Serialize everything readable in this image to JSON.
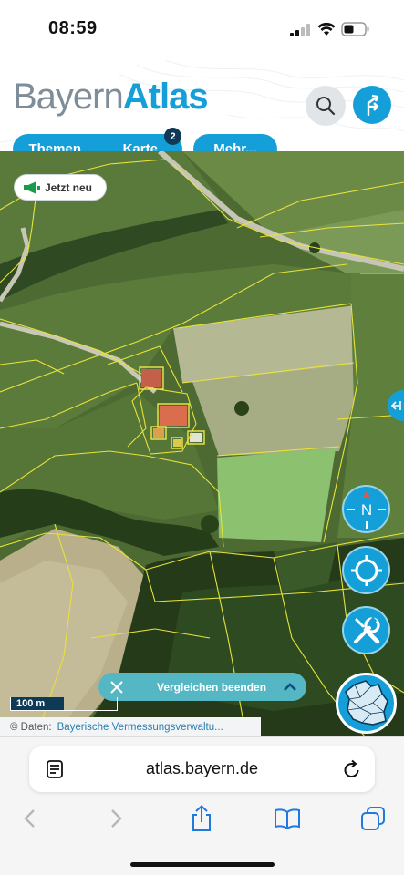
{
  "status_bar": {
    "time": "08:59"
  },
  "header": {
    "logo_part1": "Bayern",
    "logo_part2": "Atlas",
    "tabs": [
      {
        "label": "Themen"
      },
      {
        "label": "Karte"
      }
    ],
    "karte_badge": "2",
    "more_label": "Mehr..."
  },
  "map": {
    "news_chip": "Jetzt neu",
    "compass_label": "N",
    "compare_label": "Vergleichen beenden",
    "scale_label": "100 m",
    "attribution_prefix": "© Daten:",
    "attribution_source": "Bayerische Vermessungsverwaltu..."
  },
  "browser": {
    "url": "atlas.bayern.de"
  },
  "colors": {
    "brand_blue": "#159fd8",
    "logo_grey": "#7f8d99",
    "compare_teal": "#55b7c4",
    "parcel_line": "#e8e23a"
  }
}
